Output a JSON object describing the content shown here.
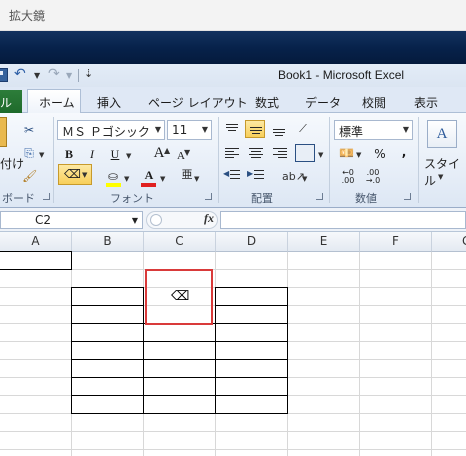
{
  "magnifier_title": "拡大鏡",
  "window_title": "Book1 - Microsoft Excel",
  "qat": {
    "customize": "⇣"
  },
  "tabs": {
    "file": "ル",
    "home": "ホーム",
    "insert": "挿入",
    "page_layout": "ページ レイアウト",
    "formulas": "数式",
    "data": "データ",
    "review": "校閲",
    "view": "表示"
  },
  "ribbon": {
    "clipboard": {
      "paste_label": "付け",
      "group_label": "ボード"
    },
    "font": {
      "font_name": "ＭＳ Ｐゴシック",
      "font_size": "11",
      "bold": "B",
      "italic": "I",
      "underline": "U",
      "grow": "A",
      "shrink": "A",
      "font_color_glyph": "A",
      "group_label": "フォント"
    },
    "alignment": {
      "group_label": "配置"
    },
    "number": {
      "format": "標準",
      "percent": "%",
      "comma": ",",
      "group_label": "数値"
    },
    "styles": {
      "label": "スタイル",
      "icon_glyph": "A"
    }
  },
  "formula_bar": {
    "name_box": "C2",
    "fx": "fx",
    "value": ""
  },
  "columns": [
    "A",
    "B",
    "C",
    "D",
    "E",
    "F",
    "G"
  ],
  "selected_cell": "C2",
  "colors": {
    "title_band": "#07224b",
    "file_tab": "#1e6a2b",
    "selection_highlight": "#d93a3a",
    "active_button": "#f8cf5a",
    "font_color_bar": "#e02020",
    "fill_color_bar": "#ffff00"
  },
  "icons": [
    "save-icon",
    "undo-icon",
    "redo-icon",
    "cut-icon",
    "copy-icon",
    "format-painter-icon",
    "eraser-icon",
    "fill-color-icon",
    "font-color-icon",
    "phonetic-icon",
    "currency-icon",
    "style-icon",
    "cursor-eraser-icon"
  ]
}
